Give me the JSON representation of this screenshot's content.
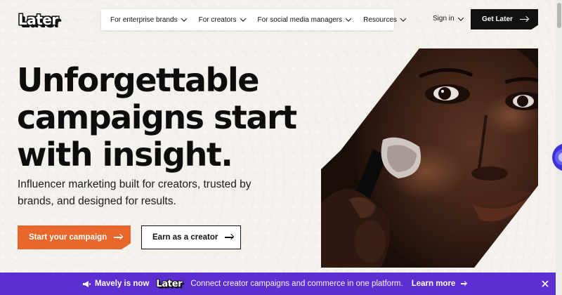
{
  "header": {
    "logo_text": "Later",
    "nav": [
      {
        "label": "For enterprise brands"
      },
      {
        "label": "For creators"
      },
      {
        "label": "For social media managers"
      },
      {
        "label": "Resources"
      }
    ],
    "signin_label": "Sign in",
    "cta_label": "Get Later"
  },
  "hero": {
    "headline": "Unforgettable campaigns start with insight.",
    "subtext": "Influencer marketing built for creators, trusted by brands, and designed for results.",
    "primary_button": "Start your campaign",
    "secondary_button": "Earn as a creator",
    "image_icon": "portrait-photo-makeup-brush"
  },
  "banner": {
    "icon": "megaphone-icon",
    "brand": "Mavely is now",
    "logo_text": "Later",
    "text": "Connect creator campaigns and commerce in one platform.",
    "link_label": "Learn more",
    "close_icon": "close-icon"
  },
  "colors": {
    "page_bg": "#f4f1ec",
    "accent_orange": "#e8672b",
    "banner_purple": "#5b2fd1",
    "dark": "#111111"
  }
}
